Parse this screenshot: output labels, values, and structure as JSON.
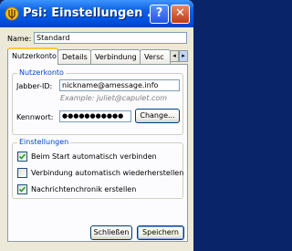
{
  "window": {
    "title": "Psi: Einstellungen ...",
    "help_glyph": "?",
    "close_glyph": "✕"
  },
  "name": {
    "label": "Name:",
    "value": "Standard"
  },
  "tabs": [
    {
      "label": "Nutzerkonto",
      "active": true
    },
    {
      "label": "Details",
      "active": false
    },
    {
      "label": "Verbindung",
      "active": false
    },
    {
      "label": "Versc",
      "active": false
    }
  ],
  "tab_scroll": {
    "left_glyph": "◂",
    "right_glyph": "▸"
  },
  "account": {
    "group_title": "Nutzerkonto",
    "jid_label": "Jabber-ID:",
    "jid_value": "nickname@amessage.info",
    "example": "Example: juliet@capulet.com",
    "password_label": "Kennwort:",
    "password_value": "●●●●●●●●●●●",
    "change_button": "Change..."
  },
  "settings": {
    "group_title": "Einstellungen",
    "options": [
      {
        "label": "Beim Start automatisch verbinden",
        "checked": true
      },
      {
        "label": "Verbindung automatisch wiederherstellen",
        "checked": false
      },
      {
        "label": "Nachrichtenchronik erstellen",
        "checked": true
      }
    ]
  },
  "footer": {
    "close_button": "Schließen",
    "save_button": "Speichern"
  },
  "colors": {
    "titlebar": "#0054e3",
    "group_title": "#0046d5",
    "check": "#21a121"
  }
}
